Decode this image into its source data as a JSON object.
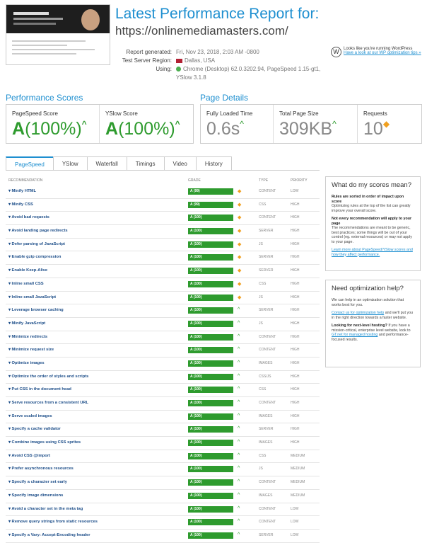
{
  "header": {
    "title": "Latest Performance Report for:",
    "url": "https://onlinemediamasters.com/",
    "meta": [
      {
        "label": "Report generated:",
        "value": "Fri, Nov 23, 2018, 2:03 AM -0800"
      },
      {
        "label": "Test Server Region:",
        "value": "Dallas, USA"
      },
      {
        "label": "Using:",
        "value": "Chrome (Desktop) 62.0.3202.94, PageSpeed 1.15-gt1, YSlow 3.1.8"
      }
    ],
    "wp_notice": "Looks like you're running WordPress",
    "wp_link": "Have a look at our WP optimization tips »"
  },
  "scores": {
    "heading": "Performance Scores",
    "pagespeed": {
      "label": "PageSpeed Score",
      "grade": "A",
      "pct": "(100%)"
    },
    "yslow": {
      "label": "YSlow Score",
      "grade": "A",
      "pct": "(100%)"
    }
  },
  "details": {
    "heading": "Page Details",
    "loaded": {
      "label": "Fully Loaded Time",
      "value": "0.6s"
    },
    "size": {
      "label": "Total Page Size",
      "value": "309KB"
    },
    "requests": {
      "label": "Requests",
      "value": "10"
    }
  },
  "tabs": [
    "PageSpeed",
    "YSlow",
    "Waterfall",
    "Timings",
    "Video",
    "History"
  ],
  "table_headers": {
    "rec": "RECOMMENDATION",
    "grade": "GRADE",
    "type": "TYPE",
    "priority": "PRIORITY"
  },
  "rows": [
    {
      "rec": "Minify HTML",
      "grade": "A (99)",
      "icon": "diamond",
      "type": "CONTENT",
      "prio": "LOW"
    },
    {
      "rec": "Minify CSS",
      "grade": "A (99)",
      "icon": "diamond",
      "type": "CSS",
      "prio": "HIGH"
    },
    {
      "rec": "Avoid bad requests",
      "grade": "A (100)",
      "icon": "diamond",
      "type": "CONTENT",
      "prio": "HIGH"
    },
    {
      "rec": "Avoid landing page redirects",
      "grade": "A (100)",
      "icon": "diamond",
      "type": "SERVER",
      "prio": "HIGH"
    },
    {
      "rec": "Defer parsing of JavaScript",
      "grade": "A (100)",
      "icon": "diamond",
      "type": "JS",
      "prio": "HIGH"
    },
    {
      "rec": "Enable gzip compression",
      "grade": "A (100)",
      "icon": "diamond",
      "type": "SERVER",
      "prio": "HIGH"
    },
    {
      "rec": "Enable Keep-Alive",
      "grade": "A (100)",
      "icon": "diamond",
      "type": "SERVER",
      "prio": "HIGH"
    },
    {
      "rec": "Inline small CSS",
      "grade": "A (100)",
      "icon": "diamond",
      "type": "CSS",
      "prio": "HIGH"
    },
    {
      "rec": "Inline small JavaScript",
      "grade": "A (100)",
      "icon": "diamond",
      "type": "JS",
      "prio": "HIGH"
    },
    {
      "rec": "Leverage browser caching",
      "grade": "A (100)",
      "icon": "up",
      "type": "SERVER",
      "prio": "HIGH"
    },
    {
      "rec": "Minify JavaScript",
      "grade": "A (100)",
      "icon": "up",
      "type": "JS",
      "prio": "HIGH"
    },
    {
      "rec": "Minimize redirects",
      "grade": "A (100)",
      "icon": "up",
      "type": "CONTENT",
      "prio": "HIGH"
    },
    {
      "rec": "Minimize request size",
      "grade": "A (100)",
      "icon": "up",
      "type": "CONTENT",
      "prio": "HIGH"
    },
    {
      "rec": "Optimize images",
      "grade": "A (100)",
      "icon": "up",
      "type": "IMAGES",
      "prio": "HIGH"
    },
    {
      "rec": "Optimize the order of styles and scripts",
      "grade": "A (100)",
      "icon": "up",
      "type": "CSS/JS",
      "prio": "HIGH"
    },
    {
      "rec": "Put CSS in the document head",
      "grade": "A (100)",
      "icon": "up",
      "type": "CSS",
      "prio": "HIGH"
    },
    {
      "rec": "Serve resources from a consistent URL",
      "grade": "A (100)",
      "icon": "up",
      "type": "CONTENT",
      "prio": "HIGH"
    },
    {
      "rec": "Serve scaled images",
      "grade": "A (100)",
      "icon": "up",
      "type": "IMAGES",
      "prio": "HIGH"
    },
    {
      "rec": "Specify a cache validator",
      "grade": "A (100)",
      "icon": "up",
      "type": "SERVER",
      "prio": "HIGH"
    },
    {
      "rec": "Combine images using CSS sprites",
      "grade": "A (100)",
      "icon": "up",
      "type": "IMAGES",
      "prio": "HIGH"
    },
    {
      "rec": "Avoid CSS @import",
      "grade": "A (100)",
      "icon": "up",
      "type": "CSS",
      "prio": "MEDIUM"
    },
    {
      "rec": "Prefer asynchronous resources",
      "grade": "A (100)",
      "icon": "up",
      "type": "JS",
      "prio": "MEDIUM"
    },
    {
      "rec": "Specify a character set early",
      "grade": "A (100)",
      "icon": "up",
      "type": "CONTENT",
      "prio": "MEDIUM"
    },
    {
      "rec": "Specify image dimensions",
      "grade": "A (100)",
      "icon": "up",
      "type": "IMAGES",
      "prio": "MEDIUM"
    },
    {
      "rec": "Avoid a character set in the meta tag",
      "grade": "A (100)",
      "icon": "up",
      "type": "CONTENT",
      "prio": "LOW"
    },
    {
      "rec": "Remove query strings from static resources",
      "grade": "A (100)",
      "icon": "up",
      "type": "CONTENT",
      "prio": "LOW"
    },
    {
      "rec": "Specify a Vary: Accept-Encoding header",
      "grade": "A (100)",
      "icon": "up",
      "type": "SERVER",
      "prio": "LOW"
    }
  ],
  "panel1": {
    "title": "What do my scores mean?",
    "b1": "Rules are sorted in order of impact upon score",
    "p1": "Optimizing rules at the top of the list can greatly improve your overall score.",
    "b2": "Not every recommendation will apply to your page",
    "p2": "The recommendations are meant to be generic, best practices; some things will be out of your control (eg. external resources) or may not apply to your page.",
    "link": "Learn more about PageSpeed/YSlow scores and how they affect performance."
  },
  "panel2": {
    "title": "Need optimization help?",
    "p1a": "We can help in an optimization solution that works best for you.",
    "link1": "Contact us for optimization help",
    "p1b": "and we'll put you in the right direction towards a faster website.",
    "b1": "Looking for next-level hosting?",
    "p2a": "If you have a mission-critical, enterprise level website, look to",
    "link2": "GT.net for managed hosting",
    "p2b": "and performance-focused results."
  }
}
